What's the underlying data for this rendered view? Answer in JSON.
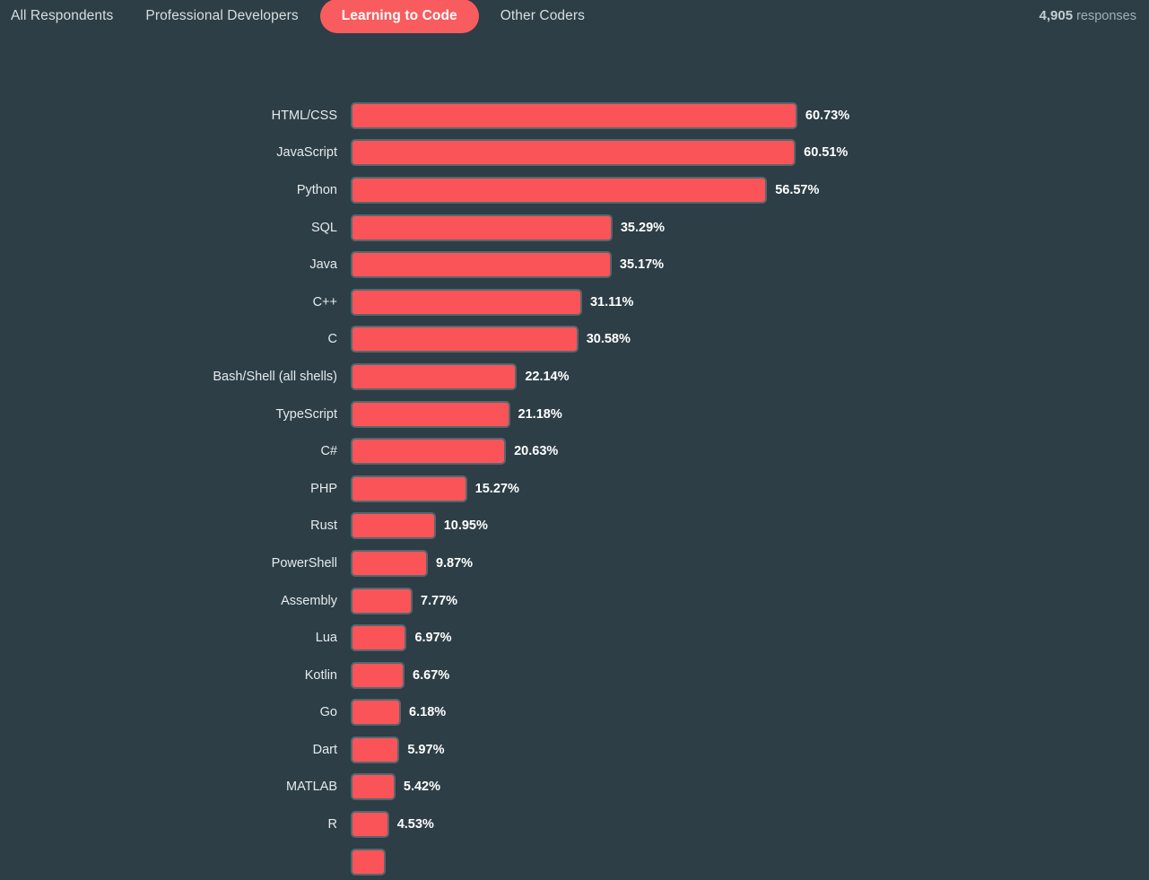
{
  "tabs": [
    {
      "label": "All Respondents",
      "active": false
    },
    {
      "label": "Professional Developers",
      "active": false
    },
    {
      "label": "Learning to Code",
      "active": true
    },
    {
      "label": "Other Coders",
      "active": false
    }
  ],
  "responses": {
    "count": "4,905",
    "label": "responses"
  },
  "colors": {
    "background": "#2d3e46",
    "bar_fill": "#fb5458",
    "bar_stroke": "#54686f",
    "accent": "#f95c5e",
    "tab_inactive_text": "#d9dee0",
    "value_text": "#ffffff",
    "responses_text": "#9fb0b6"
  },
  "chart_data": {
    "type": "bar",
    "orientation": "horizontal",
    "title": "",
    "xlabel": "",
    "ylabel": "",
    "xlim": [
      0,
      100
    ],
    "grid": false,
    "legend": false,
    "value_suffix": "%",
    "categories": [
      "HTML/CSS",
      "JavaScript",
      "Python",
      "SQL",
      "Java",
      "C++",
      "C",
      "Bash/Shell (all shells)",
      "TypeScript",
      "C#",
      "PHP",
      "Rust",
      "PowerShell",
      "Assembly",
      "Lua",
      "Kotlin",
      "Go",
      "Dart",
      "MATLAB",
      "R",
      ""
    ],
    "values": [
      60.73,
      60.51,
      56.57,
      35.29,
      35.17,
      31.11,
      30.58,
      22.14,
      21.18,
      20.63,
      15.27,
      10.95,
      9.87,
      7.77,
      6.97,
      6.67,
      6.18,
      5.97,
      5.42,
      4.53,
      4.1
    ],
    "value_labels": [
      "60.73%",
      "60.51%",
      "56.57%",
      "35.29%",
      "35.17%",
      "31.11%",
      "30.58%",
      "22.14%",
      "21.18%",
      "20.63%",
      "15.27%",
      "10.95%",
      "9.87%",
      "7.77%",
      "6.97%",
      "6.67%",
      "6.18%",
      "5.97%",
      "5.42%",
      "4.53%",
      ""
    ]
  }
}
